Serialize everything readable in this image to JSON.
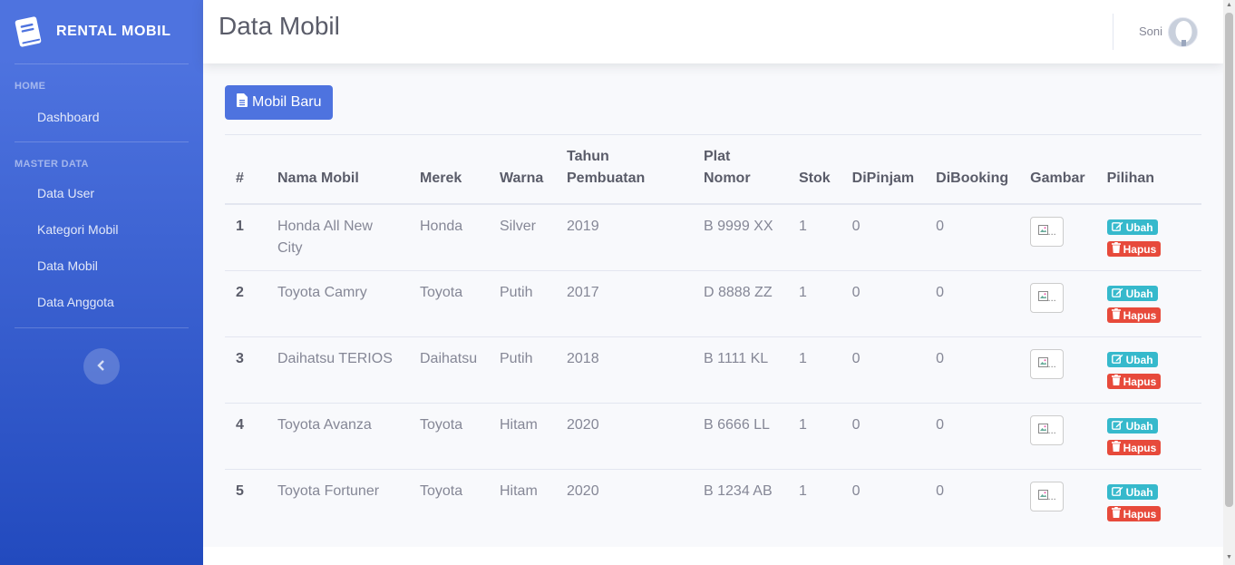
{
  "brand": {
    "name": "RENTAL MOBIL",
    "icon": "book-icon"
  },
  "sidebar": {
    "sections": [
      {
        "heading": "HOME",
        "items": [
          {
            "label": "Dashboard"
          }
        ]
      },
      {
        "heading": "MASTER DATA",
        "items": [
          {
            "label": "Data User"
          },
          {
            "label": "Kategori Mobil"
          },
          {
            "label": "Data Mobil"
          },
          {
            "label": "Data Anggota"
          }
        ]
      }
    ],
    "toggle_icon": "chevron-left-icon"
  },
  "topbar": {
    "title": "Data Mobil",
    "user_name": "Soni"
  },
  "actions": {
    "new_label": "Mobil Baru",
    "new_icon": "file-icon"
  },
  "table": {
    "headers": [
      "#",
      "Nama Mobil",
      "Merek",
      "Warna",
      "Tahun Pembuatan",
      "Plat Nomor",
      "Stok",
      "DiPinjam",
      "DiBooking",
      "Gambar",
      "Pilihan"
    ],
    "rows": [
      {
        "no": "1",
        "nama": "Honda All New City",
        "merek": "Honda",
        "warna": "Silver",
        "tahun": "2019",
        "plat": "B 9999 XX",
        "stok": "1",
        "dipinjam": "0",
        "dibooking": "0",
        "gambar": "..."
      },
      {
        "no": "2",
        "nama": "Toyota Camry",
        "merek": "Toyota",
        "warna": "Putih",
        "tahun": "2017",
        "plat": "D 8888 ZZ",
        "stok": "1",
        "dipinjam": "0",
        "dibooking": "0",
        "gambar": "..."
      },
      {
        "no": "3",
        "nama": "Daihatsu TERIOS",
        "merek": "Daihatsu",
        "warna": "Putih",
        "tahun": "2018",
        "plat": "B 1111 KL",
        "stok": "1",
        "dipinjam": "0",
        "dibooking": "0",
        "gambar": "..."
      },
      {
        "no": "4",
        "nama": "Toyota Avanza",
        "merek": "Toyota",
        "warna": "Hitam",
        "tahun": "2020",
        "plat": "B 6666 LL",
        "stok": "1",
        "dipinjam": "0",
        "dibooking": "0",
        "gambar": "..."
      },
      {
        "no": "5",
        "nama": "Toyota Fortuner",
        "merek": "Toyota",
        "warna": "Hitam",
        "tahun": "2020",
        "plat": "B 1234 AB",
        "stok": "1",
        "dipinjam": "0",
        "dibooking": "0",
        "gambar": "..."
      }
    ],
    "edit_label": "Ubah",
    "delete_label": "Hapus"
  },
  "colors": {
    "primary": "#4e73df",
    "info": "#36b9cc",
    "danger": "#e74a3b"
  }
}
